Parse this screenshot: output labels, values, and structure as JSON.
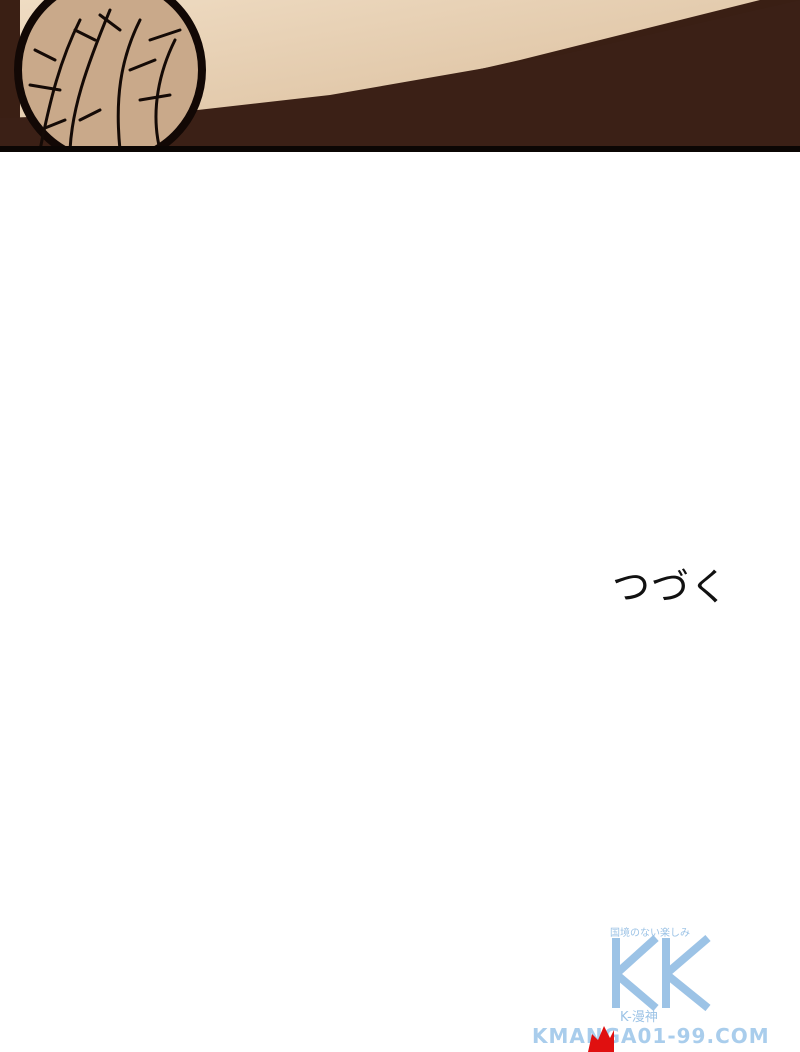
{
  "comic": {
    "panel_label": "",
    "end_text": "つづく"
  },
  "watermark": {
    "tagline": "国境のない楽しみ",
    "logo_letter": "K",
    "subtitle": "K-漫神",
    "url": "KMANGA01-99.COM"
  },
  "colors": {
    "panel_dark": "#3a1f14",
    "panel_sky": "#e8d2b8",
    "watermark_blue": "#9cc3e6",
    "accent_red": "#e01010"
  }
}
